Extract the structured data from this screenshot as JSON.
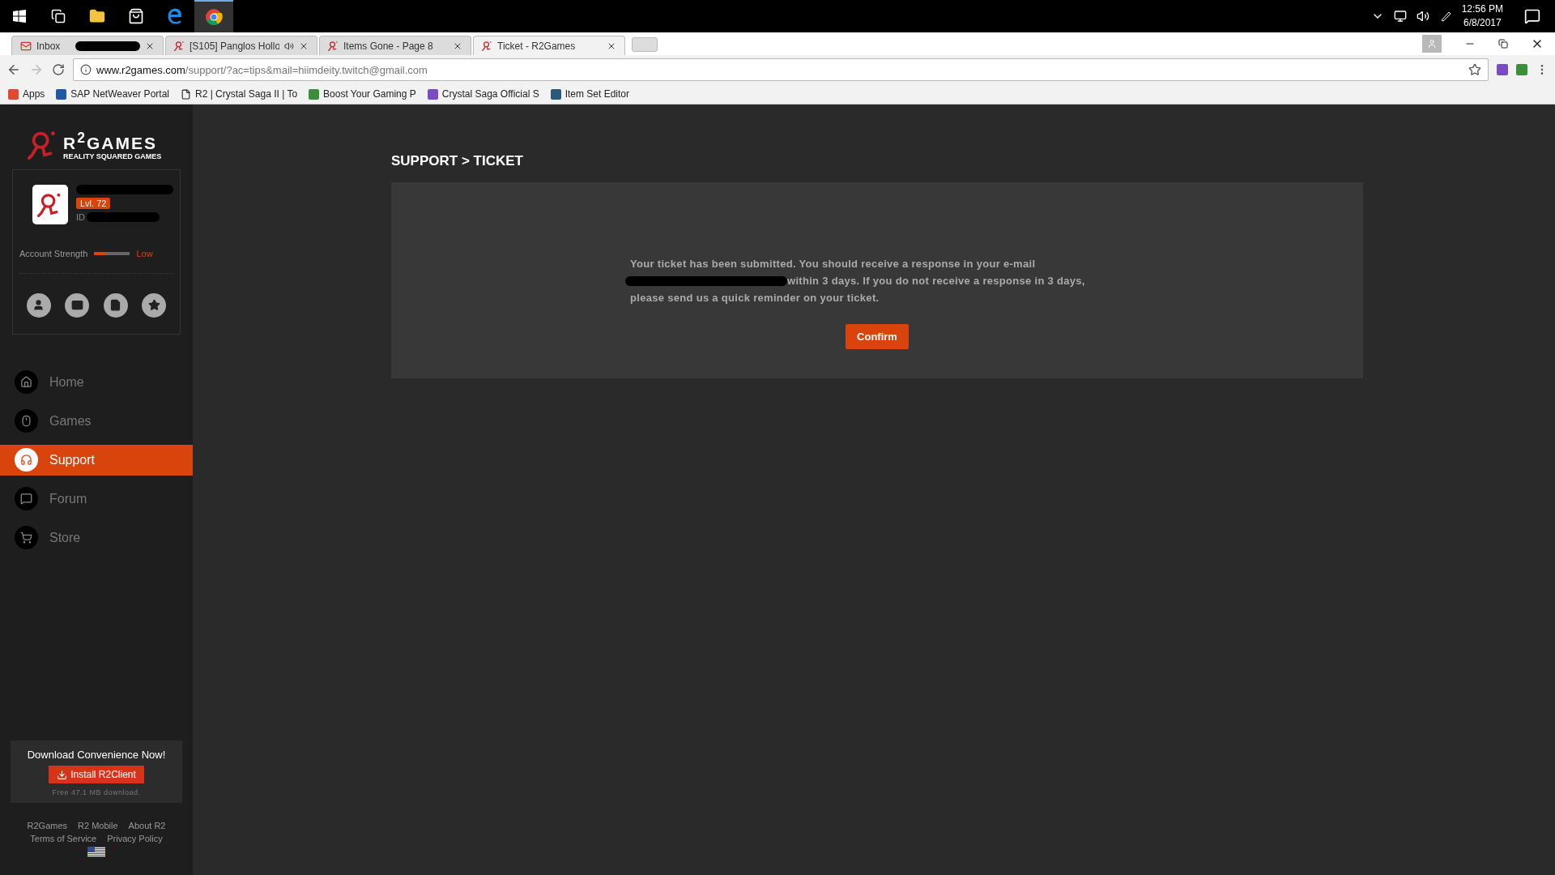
{
  "taskbar": {
    "time": "12:56 PM",
    "date": "6/8/2017"
  },
  "browser": {
    "tabs": [
      {
        "title": "Inbox",
        "selected": false,
        "redacted": true,
        "audio": false
      },
      {
        "title": "[S105] Panglos Hollo",
        "selected": false,
        "redacted": false,
        "audio": true
      },
      {
        "title": "Items Gone - Page 8",
        "selected": false,
        "redacted": false,
        "audio": false
      },
      {
        "title": "Ticket - R2Games",
        "selected": true,
        "redacted": false,
        "audio": false
      }
    ],
    "url_host": "www.r2games.com",
    "url_path": "/support/?ac=tips&mail=hiimdeity.twitch@gmail.com",
    "bookmarks": [
      "Apps",
      "SAP NetWeaver Portal",
      "R2 | Crystal Saga II | To",
      "Boost Your Gaming P",
      "Crystal Saga Official S",
      "Item Set Editor"
    ]
  },
  "sidebar": {
    "logo_title": "R$^{2}$GAMES",
    "logo_subtitle": "REALITY SQUARED GAMES",
    "profile": {
      "level": "Lvl. 72",
      "id_label": "ID",
      "strength_label": "Account Strength",
      "strength": {
        "level": 0.33
      },
      "strength_value": "Low"
    },
    "nav": [
      {
        "label": "Home",
        "selected": false
      },
      {
        "label": "Games",
        "selected": false
      },
      {
        "label": "Support",
        "selected": true
      },
      {
        "label": "Forum",
        "selected": false
      },
      {
        "label": "Store",
        "selected": false
      }
    ],
    "download": {
      "title": "Download Convenience Now!",
      "button": "Install R2Client",
      "note": "Free 47.1 MB download."
    },
    "footer_links": [
      [
        "R2Games",
        "R2 Mobile",
        "About R2"
      ],
      [
        "Terms of Service",
        "Privacy Policy"
      ]
    ]
  },
  "main": {
    "breadcrumb": "SUPPORT > TICKET",
    "message_lines": [
      "Your ticket has been submitted. You should receive a response in your e-mail",
      "within 3 days. If you do not receive a response in 3 days,",
      "please send us a quick reminder on your ticket."
    ],
    "confirm": "Confirm"
  }
}
